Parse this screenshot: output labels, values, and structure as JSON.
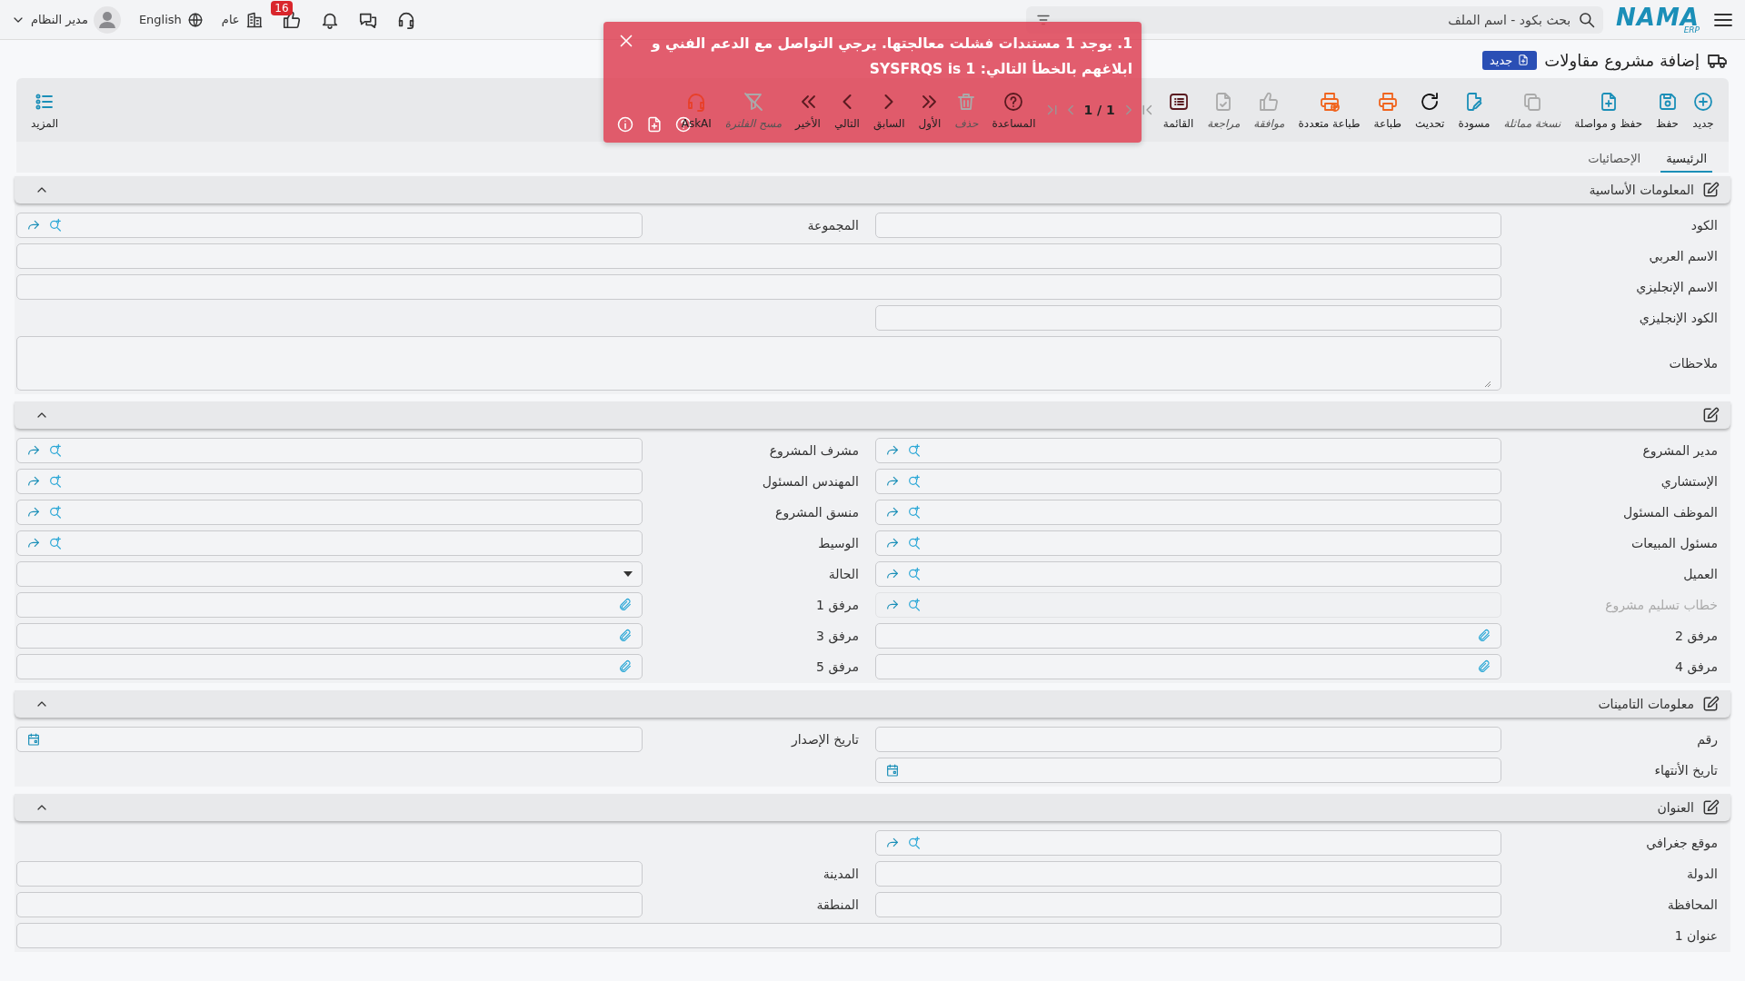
{
  "topbar": {
    "logo": "NAMA",
    "logo_sub": "ERP",
    "search": {
      "placeholder": "بحث بكود - اسم الملف"
    },
    "likes_badge": "16",
    "company": "عام",
    "language": "English",
    "user": "مدير النظام"
  },
  "page": {
    "title": "إضافة مشروع مقاولات",
    "status_badge": "جديد"
  },
  "toolbar": [
    {
      "kind": "button",
      "label": "جديد",
      "disabled": false
    },
    {
      "kind": "button",
      "label": "حفظ",
      "disabled": false
    },
    {
      "kind": "button",
      "label": "حفظ و مواصلة",
      "disabled": false
    },
    {
      "kind": "button",
      "label": "نسخة مماثلة",
      "disabled": true
    },
    {
      "kind": "button",
      "label": "مسودة",
      "disabled": false
    },
    {
      "kind": "button",
      "label": "تحديث",
      "disabled": false
    },
    {
      "kind": "button",
      "label": "طباعة",
      "disabled": false
    },
    {
      "kind": "button",
      "label": "طباعة متعددة",
      "disabled": false
    },
    {
      "kind": "button",
      "label": "موافقة",
      "disabled": true
    },
    {
      "kind": "button",
      "label": "مراجعة",
      "disabled": true
    },
    {
      "kind": "button",
      "label": "القائمة",
      "disabled": false
    },
    {
      "kind": "pager",
      "label": "1 / 1"
    },
    {
      "kind": "button",
      "label": "المساعدة",
      "disabled": false
    },
    {
      "kind": "button",
      "label": "حذف",
      "disabled": true
    },
    {
      "kind": "button",
      "label": "الأول",
      "disabled": false
    },
    {
      "kind": "button",
      "label": "السابق",
      "disabled": false
    },
    {
      "kind": "button",
      "label": "التالي",
      "disabled": false
    },
    {
      "kind": "button",
      "label": "الأخير",
      "disabled": false
    },
    {
      "kind": "button",
      "label": "مسح الفلترة",
      "disabled": true
    },
    {
      "kind": "button",
      "label": "AskAI",
      "disabled": false
    }
  ],
  "more": "المزيد",
  "toast": {
    "kind": "error",
    "message": "1. يوجد 1 مستندات فشلت معالجتها. يرجي التواصل مع الدعم الفني و ابلاغهم بالخطأ التالي: SYSFRQS is 1"
  },
  "tabs": [
    {
      "label": "الرئيسية",
      "selected": true
    },
    {
      "label": "الإحصائيات",
      "selected": false
    }
  ],
  "sections": [
    {
      "title": "المعلومات الأساسية",
      "expanded": true,
      "rows": [
        [
          {
            "label": "الكود",
            "kind": "text",
            "disabled": false
          },
          {
            "label": "المجموعة",
            "kind": "lookup",
            "disabled": false
          }
        ],
        [
          {
            "label": "الاسم العربي",
            "kind": "wide",
            "disabled": false
          }
        ],
        [
          {
            "label": "الاسم الإنجليزي",
            "kind": "wide",
            "disabled": false
          }
        ],
        [
          {
            "label": "الكود الإنجليزي",
            "kind": "text",
            "disabled": false
          }
        ],
        [
          {
            "label": "ملاحظات",
            "kind": "notes",
            "disabled": false
          }
        ]
      ]
    },
    {
      "expanded": true,
      "rows": [
        [
          {
            "label": "مدير المشروع",
            "kind": "lookup",
            "disabled": false
          },
          {
            "label": "مشرف المشروع",
            "kind": "lookup",
            "disabled": false
          }
        ],
        [
          {
            "label": "الإستشاري",
            "kind": "lookup",
            "disabled": false
          },
          {
            "label": "المهندس المسئول",
            "kind": "lookup",
            "disabled": false
          }
        ],
        [
          {
            "label": "الموظف المسئول",
            "kind": "lookup",
            "disabled": false
          },
          {
            "label": "منسق المشروع",
            "kind": "lookup",
            "disabled": false
          }
        ],
        [
          {
            "label": "مسئول المبيعات",
            "kind": "lookup",
            "disabled": false
          },
          {
            "label": "الوسيط",
            "kind": "lookup",
            "disabled": false
          }
        ],
        [
          {
            "label": "العميل",
            "kind": "lookup",
            "disabled": false
          },
          {
            "label": "الحالة",
            "kind": "select",
            "disabled": false
          }
        ],
        [
          {
            "label": "خطاب تسليم مشروع",
            "kind": "lookup",
            "disabled": true
          },
          {
            "label": "مرفق 1",
            "kind": "attachment",
            "disabled": false
          }
        ],
        [
          {
            "label": "مرفق 2",
            "kind": "attachment",
            "disabled": false
          },
          {
            "label": "مرفق 3",
            "kind": "attachment",
            "disabled": false
          }
        ],
        [
          {
            "label": "مرفق 4",
            "kind": "attachment",
            "disabled": false
          },
          {
            "label": "مرفق 5",
            "kind": "attachment",
            "disabled": false
          }
        ]
      ]
    },
    {
      "title": "معلومات التامينات",
      "expanded": true,
      "rows": [
        [
          {
            "label": "رقم",
            "kind": "text",
            "disabled": false
          },
          {
            "label": "تاريخ الإصدار",
            "kind": "date",
            "disabled": false
          }
        ],
        [
          {
            "label": "تاريخ الأنتهاء",
            "kind": "date",
            "disabled": false
          }
        ]
      ]
    },
    {
      "title": "العنوان",
      "expanded": true,
      "rows": [
        [
          {
            "label": "موقع جغرافي",
            "kind": "lookup",
            "disabled": false
          }
        ],
        [
          {
            "label": "الدولة",
            "kind": "text",
            "disabled": false
          },
          {
            "label": "المدينة",
            "kind": "text",
            "disabled": false
          }
        ],
        [
          {
            "label": "المحافظة",
            "kind": "text",
            "disabled": false
          },
          {
            "label": "المنطقة",
            "kind": "text",
            "disabled": false
          }
        ],
        [
          {
            "label": "عنوان 1",
            "kind": "wide",
            "disabled": false
          }
        ]
      ]
    }
  ]
}
